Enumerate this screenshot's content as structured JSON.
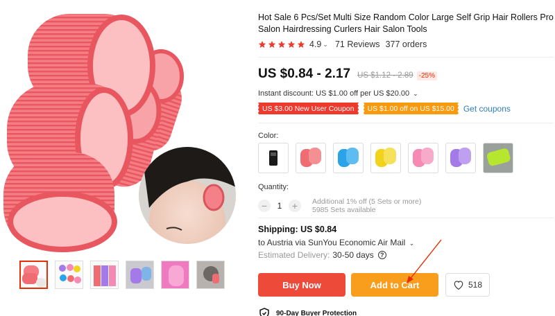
{
  "product": {
    "title": "Hot Sale 6 Pcs/Set Multi Size Random Color Large Self Grip Hair Rollers Pro Salon Hairdressing Curlers Hair Salon Tools",
    "rating": "4.9",
    "reviews": "71 Reviews",
    "orders": "377 orders",
    "price": "US $0.84 - 2.17",
    "old_price": "US $1.12 - 2.89",
    "discount": "-25%",
    "instant_discount": "Instant discount: US $1.00 off per US $20.00",
    "coupons": [
      "US $3.00 New User Coupon",
      "US $1.00 off on US $15.00"
    ],
    "get_coupons": "Get coupons",
    "color_label": "Color:",
    "swatch_colors": [
      "#1a1a1a",
      "#ef6d72",
      "#2aa3e8",
      "#f2d21b",
      "#f58ab4",
      "#a47ae8",
      "#b7e62e"
    ],
    "quantity_label": "Quantity:",
    "quantity": "1",
    "quantity_note_1": "Additional 1% off (5 Sets or more)",
    "quantity_note_2": "5985 Sets available",
    "shipping_label": "Shipping: US $0.84",
    "shipping_dest": "to Austria via SunYou Economic Air Mail",
    "delivery_label": "Estimated Delivery:",
    "delivery_days": "30-50 days",
    "buy_now": "Buy Now",
    "add_to_cart": "Add to Cart",
    "wishlist_count": "518",
    "protection": "90-Day Buyer Protection"
  },
  "colors": {
    "accent_red": "#ee4a3a",
    "accent_orange": "#f99d1c",
    "link_blue": "#2f7ec2",
    "star": "#ee3a2d",
    "roller_pink": "#ef6d72"
  }
}
